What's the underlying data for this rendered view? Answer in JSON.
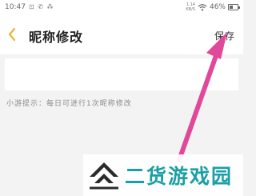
{
  "status_bar": {
    "time": "10:47",
    "left_icons": "⊡ ✆ ⁂",
    "net_speed_value": "1.14",
    "net_speed_unit": "KB/S",
    "battery_percent": "46%",
    "battery_level": 0.46
  },
  "nav": {
    "title": "昵称修改",
    "save_label": "保存"
  },
  "nickname_input": {
    "value": ""
  },
  "tip": "小游提示：每日可进行1次昵称修改",
  "watermark": {
    "text": "二货游戏园",
    "color": "#1a9fa6"
  },
  "annotation_arrow": {
    "color": "#e0489a"
  },
  "accent_color": "#e0b93a"
}
